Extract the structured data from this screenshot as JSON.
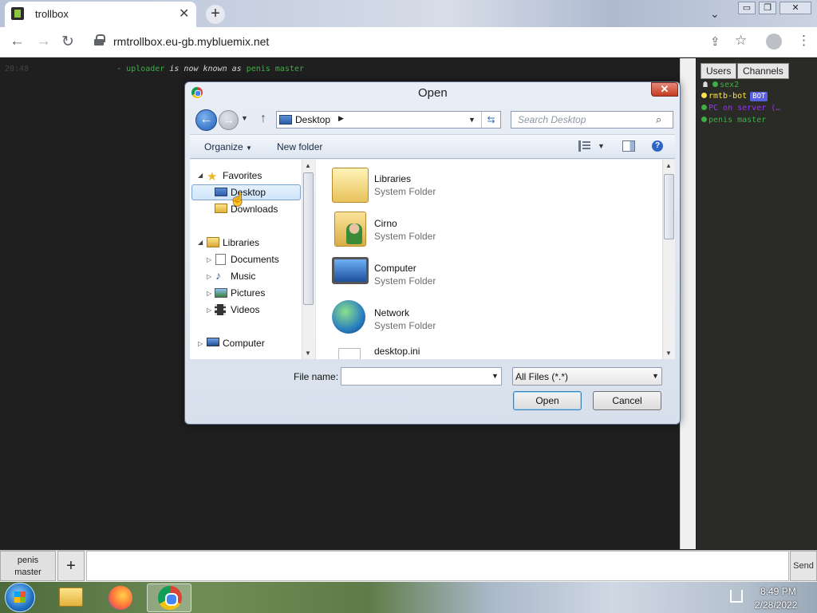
{
  "browser": {
    "tab_title": "trollbox",
    "tab_close": "✕",
    "new_tab": "+",
    "url": "rmtrollbox.eu-gb.mybluemix.net",
    "back": "←",
    "forward": "→",
    "reload": "↻",
    "share": "⇪",
    "bookmark": "☆",
    "menu": "⋮",
    "tab_chevron": "⌄",
    "win_min": "▭",
    "win_restore": "❐",
    "win_close": "✕"
  },
  "chat": {
    "time": "20:48",
    "arrow": "-",
    "old_name": "uploader",
    "middle": "is now known as",
    "new_name": "penis master"
  },
  "sidebar": {
    "tabs": [
      "Users",
      "Channels"
    ],
    "users": [
      {
        "name": "sex2",
        "color": "#3cb043",
        "prefix": "☗"
      },
      {
        "name": "rmtb-bot",
        "color": "#ffe44d",
        "badge": "BOT"
      },
      {
        "name": "PC on server (…",
        "color": "#9b30ff"
      },
      {
        "name": "penis master",
        "color": "#3cb043"
      }
    ]
  },
  "bottombar": {
    "nick_line1": "penis",
    "nick_line2": "master",
    "add": "+",
    "send": "Send"
  },
  "dialog": {
    "title": "Open",
    "close": "✕",
    "back": "←",
    "forward": "→",
    "up": "↑",
    "address": "Desktop",
    "refresh": "⇆",
    "search_placeholder": "Search Desktop",
    "organize": "Organize",
    "new_folder": "New folder",
    "help": "?",
    "nav": {
      "favorites": "Favorites",
      "desktop": "Desktop",
      "downloads": "Downloads",
      "libraries": "Libraries",
      "documents": "Documents",
      "music": "Music",
      "pictures": "Pictures",
      "videos": "Videos",
      "computer": "Computer"
    },
    "files": [
      {
        "name": "Libraries",
        "type": "System Folder",
        "icon": "libraries-icon"
      },
      {
        "name": "Cirno",
        "type": "System Folder",
        "icon": "user-folder-icon"
      },
      {
        "name": "Computer",
        "type": "System Folder",
        "icon": "computer-icon"
      },
      {
        "name": "Network",
        "type": "System Folder",
        "icon": "network-icon"
      },
      {
        "name": "desktop.ini",
        "type": "",
        "icon": "file-icon"
      }
    ],
    "file_name_label": "File name:",
    "file_name_value": "",
    "filter": "All Files (*.*)",
    "open_label": "Open",
    "cancel_label": "Cancel"
  },
  "taskbar": {
    "time": "8:49 PM",
    "date": "2/28/2022"
  },
  "colors": {
    "chat_time": "#444444",
    "chat_name": "#3cb043",
    "chat_text": "#d8d8d8",
    "bot_badge": "#5860e0"
  }
}
